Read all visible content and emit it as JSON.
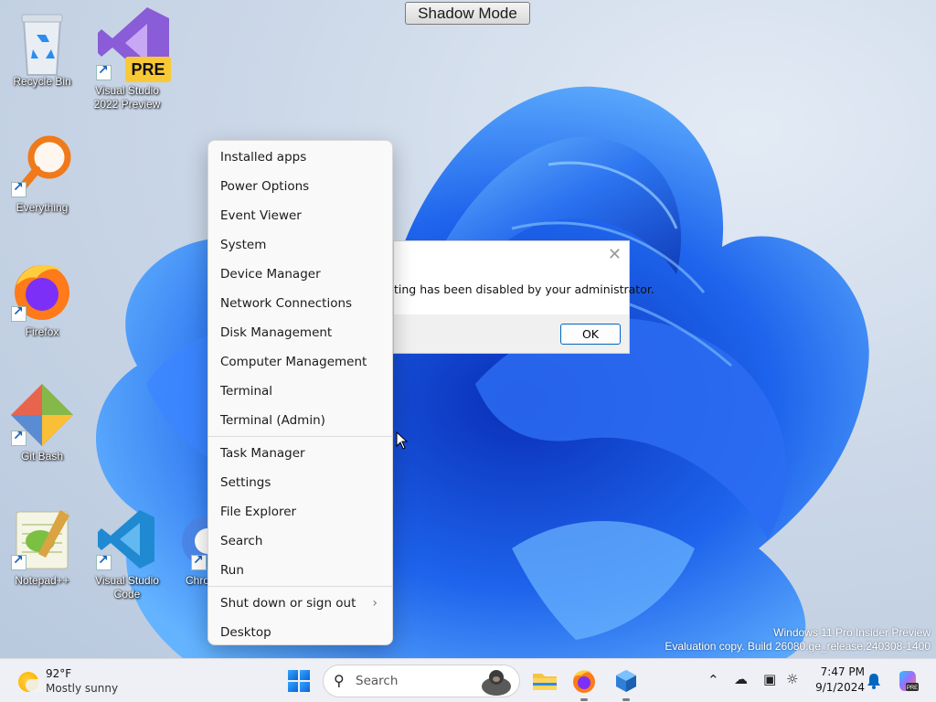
{
  "top_button": {
    "label": "Shadow Mode"
  },
  "desktop_icons": [
    {
      "label": "Recycle Bin"
    },
    {
      "label": "Visual Studio 2022 Preview",
      "badge": "PRE"
    },
    {
      "label": "Everything"
    },
    {
      "label": "Firefox"
    },
    {
      "label": "Git Bash"
    },
    {
      "label": "Notepad++"
    },
    {
      "label": "Visual Studio Code"
    },
    {
      "label": "Chro"
    }
  ],
  "context_menu": {
    "items": [
      "Installed apps",
      "Power Options",
      "Event Viewer",
      "System",
      "Device Manager",
      "Network Connections",
      "Disk Management",
      "Computer Management",
      "Terminal",
      "Terminal (Admin)",
      "Task Manager",
      "Settings",
      "File Explorer",
      "Search",
      "Run",
      "Shut down or sign out",
      "Desktop"
    ]
  },
  "dialog": {
    "message": "ting has been disabled by your administrator.",
    "ok_label": "OK",
    "close_glyph": "✕"
  },
  "watermark": {
    "line1": "Windows 11 Pro Insider Preview",
    "line2": "Evaluation copy. Build 26080.ge_release.240308-1400"
  },
  "taskbar": {
    "weather_temp": "92°F",
    "weather_desc": "Mostly sunny",
    "search_placeholder": "Search",
    "time": "7:47 PM",
    "date": "9/1/2024"
  },
  "icons": {
    "search": "search-icon",
    "chevron": "chevron-right-icon",
    "tray_up": "chevron-up-icon"
  },
  "colors": {
    "accent": "#0067c0",
    "wallpaper_blue": "#1f5fe0"
  }
}
